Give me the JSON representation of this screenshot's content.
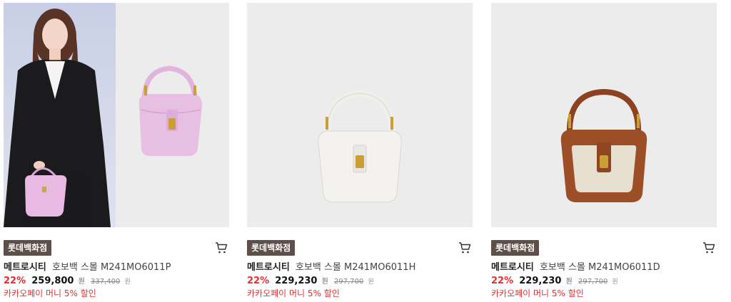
{
  "products": [
    {
      "badge": "롯데백화점",
      "brand": "메트로시티",
      "name": "호보백 스몰 M241MO6011P",
      "discount": "22%",
      "price": "259,800",
      "currency": "원",
      "original_price": "337,400",
      "promo": "카카오페이 머니 5% 할인",
      "bag_color": "#e7bfe3"
    },
    {
      "badge": "롯데백화점",
      "brand": "메트로시티",
      "name": "호보백 스몰 M241MO6011H",
      "discount": "22%",
      "price": "229,230",
      "currency": "원",
      "original_price": "297,700",
      "promo": "카카오페이 머니 5% 할인",
      "bag_color": "#f1f0ec"
    },
    {
      "badge": "롯데백화점",
      "brand": "메트로시티",
      "name": "호보백 스몰 M241MO6011D",
      "discount": "22%",
      "price": "229,230",
      "currency": "원",
      "original_price": "297,700",
      "promo": "카카오페이 머니 5% 할인",
      "bag_color": "#a0522d"
    }
  ],
  "icons": {
    "cart": "cart-icon"
  }
}
